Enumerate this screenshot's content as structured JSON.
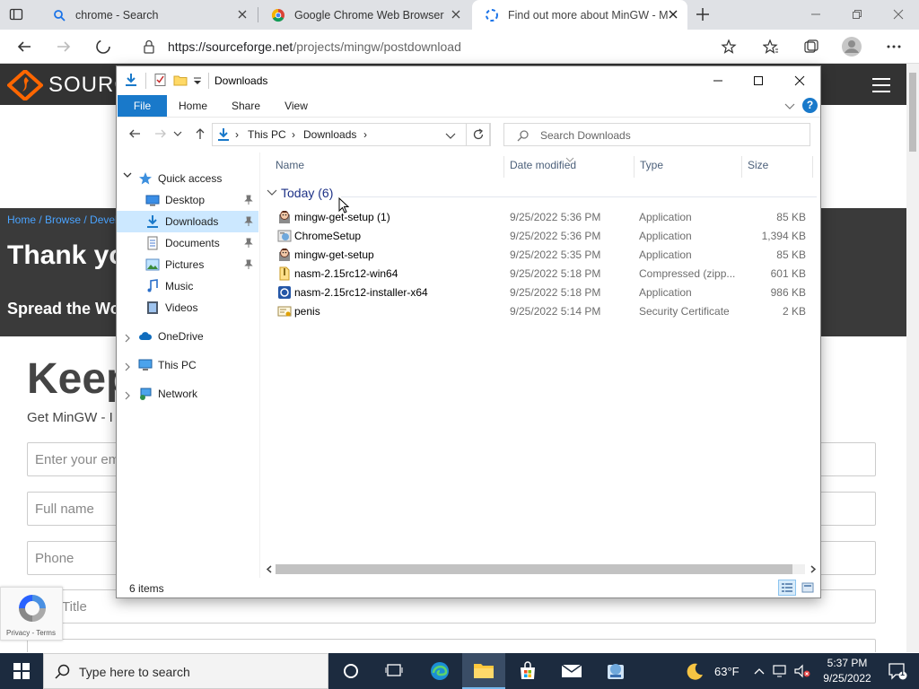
{
  "browser": {
    "tabs": [
      {
        "title": "chrome - Search"
      },
      {
        "title": "Google Chrome Web Browser"
      },
      {
        "title": "Find out more about MinGW - M"
      }
    ],
    "url_host": "https://sourceforge.net",
    "url_path": "/projects/mingw/postdownload"
  },
  "site": {
    "logo_text": "SOURC",
    "breadcrumb": "Home / Browse / Devel",
    "hero_title": "Thank yo",
    "hero_sub": "Spread the Wor",
    "keep": "Keep",
    "get_mingw": "Get MinGW - I",
    "fields": [
      {
        "placeholder": "Enter your em"
      },
      {
        "placeholder": "Full name"
      },
      {
        "placeholder": "Phone"
      },
      {
        "placeholder": "Title"
      }
    ],
    "recaptcha_text": "Privacy - Terms"
  },
  "explorer": {
    "title": "Downloads",
    "ribbon_tabs": [
      "File",
      "Home",
      "Share",
      "View"
    ],
    "address": [
      "This PC",
      "Downloads"
    ],
    "search_placeholder": "Search Downloads",
    "nav": {
      "quick_access": "Quick access",
      "pinned": [
        "Desktop",
        "Downloads",
        "Documents",
        "Pictures"
      ],
      "unpinned": [
        "Music",
        "Videos"
      ],
      "onedrive": "OneDrive",
      "this_pc": "This PC",
      "network": "Network"
    },
    "columns": [
      "Name",
      "Date modified",
      "Type",
      "Size"
    ],
    "group_label": "Today (6)",
    "files": [
      {
        "name": "mingw-get-setup (1)",
        "date": "9/25/2022 5:36 PM",
        "type": "Application",
        "size": "85 KB",
        "icon": "installer-icon"
      },
      {
        "name": "ChromeSetup",
        "date": "9/25/2022 5:36 PM",
        "type": "Application",
        "size": "1,394 KB",
        "icon": "setup-icon"
      },
      {
        "name": "mingw-get-setup",
        "date": "9/25/2022 5:35 PM",
        "type": "Application",
        "size": "85 KB",
        "icon": "installer-icon"
      },
      {
        "name": "nasm-2.15rc12-win64",
        "date": "9/25/2022 5:18 PM",
        "type": "Compressed (zipp...",
        "size": "601 KB",
        "icon": "zip-icon"
      },
      {
        "name": "nasm-2.15rc12-installer-x64",
        "date": "9/25/2022 5:18 PM",
        "type": "Application",
        "size": "986 KB",
        "icon": "app-icon"
      },
      {
        "name": "penis",
        "date": "9/25/2022 5:14 PM",
        "type": "Security Certificate",
        "size": "2 KB",
        "icon": "certificate-icon"
      }
    ],
    "status": "6 items"
  },
  "taskbar": {
    "search_placeholder": "Type here to search",
    "temperature": "63°F",
    "time": "5:37 PM",
    "date": "9/25/2022",
    "notification_count": "1"
  },
  "colors": {
    "accent": "#1979ca",
    "selection": "#cce8ff",
    "taskbar": "#1c2b3f",
    "site_dark": "#333333"
  }
}
